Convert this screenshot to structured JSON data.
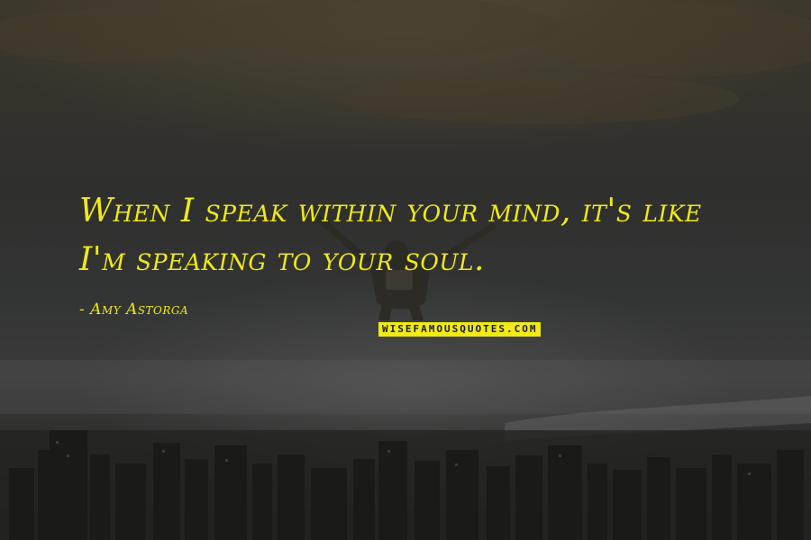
{
  "quote": {
    "text": "When I speak within your mind, it's like I'm speaking to your soul.",
    "author": "- Amy Astorga"
  },
  "brand": {
    "label": "WISEFAMOUSQUOTES.COM"
  },
  "background": {
    "subject": "skydiver in free fall above a city",
    "icon": "skydiver-silhouette"
  },
  "colors": {
    "accent": "#f1ea14",
    "background": "#2f2f2d"
  }
}
